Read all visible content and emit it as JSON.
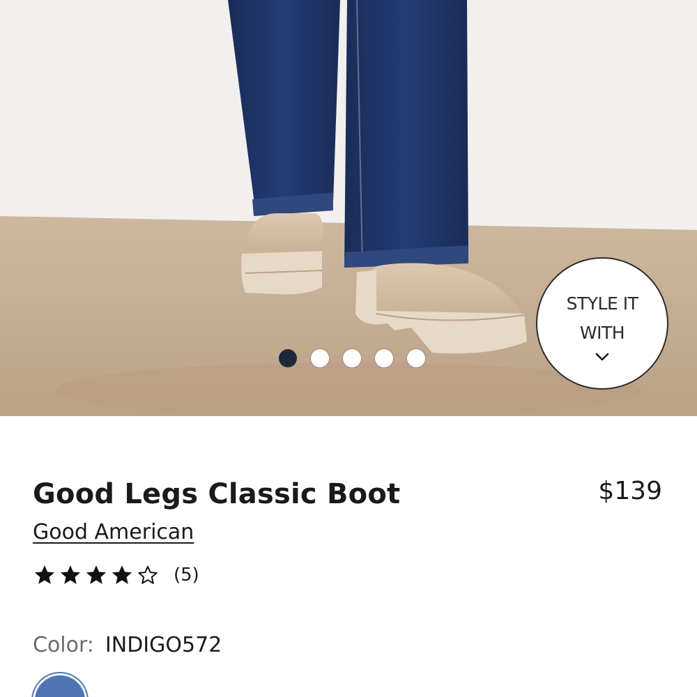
{
  "hero": {
    "carousel": {
      "count": 5,
      "active_index": 0
    },
    "style_it_button": {
      "label": "STYLE IT\nWITH",
      "icon": "chevron-down-icon"
    }
  },
  "product": {
    "title": "Good Legs Classic Boot",
    "price": "$139",
    "brand": "Good American",
    "rating": {
      "value": 4,
      "max": 5,
      "count_label": "(5)"
    },
    "color": {
      "label": "Color:",
      "value": "INDIGO572"
    },
    "swatches": [
      {
        "name": "INDIGO572",
        "hex": "#4f76b4",
        "selected": true
      }
    ]
  },
  "colors": {
    "active_dot": "#1c2a38",
    "text": "#1a1a1a",
    "muted_text": "#6b6b6b",
    "denim": "#1f3566",
    "boot": "#d6c2aa",
    "floor": "#c4ad93",
    "wall": "#f2f0ee"
  }
}
